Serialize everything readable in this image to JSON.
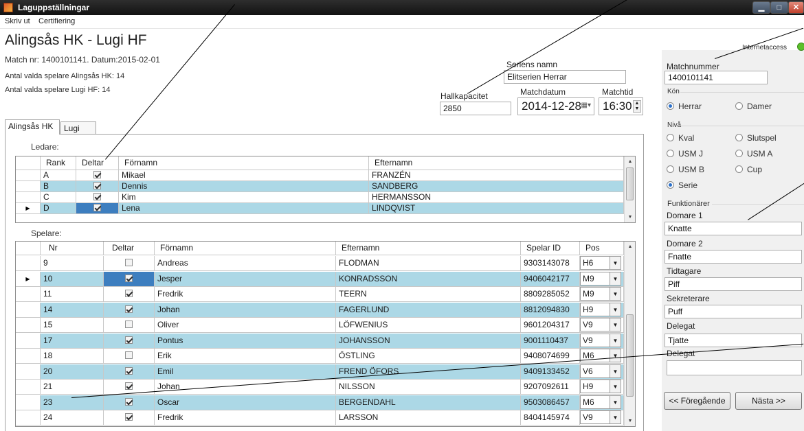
{
  "window": {
    "title": "Laguppställningar"
  },
  "menu": [
    "Skriv ut",
    "Certifiering"
  ],
  "match": {
    "title": "Alingsås HK - Lugi HF",
    "info_line": "Match nr: 1400101141.  Datum:2015-02-01",
    "count_home": "Antal valda spelare Alingsås HK: 14",
    "count_away": "Antal valda spelare Lugi HF: 14"
  },
  "fields": {
    "series_label": "Seriens namn",
    "series_value": "Elitserien Herrar",
    "capacity_label": "Hallkapacitet",
    "capacity_value": "2850",
    "date_label": "Matchdatum",
    "date_value": "2014-12-28",
    "time_label": "Matchtid",
    "time_value": "16:30"
  },
  "panel": {
    "internet_label": "Internetaccess",
    "matchnr_label": "Matchnummer",
    "matchnr_value": "1400101141",
    "gender_title": "Kön",
    "gender": [
      {
        "label": "Herrar",
        "checked": true
      },
      {
        "label": "Damer",
        "checked": false
      }
    ],
    "level_title": "Nivå",
    "levels": [
      {
        "label": "Kval",
        "checked": false
      },
      {
        "label": "Slutspel",
        "checked": false
      },
      {
        "label": "USM J",
        "checked": false
      },
      {
        "label": "USM A",
        "checked": false
      },
      {
        "label": "USM B",
        "checked": false
      },
      {
        "label": "Cup",
        "checked": false
      },
      {
        "label": "Serie",
        "checked": true
      }
    ],
    "officials_title": "Funktionärer",
    "officials": [
      {
        "label": "Domare 1",
        "value": "Knatte"
      },
      {
        "label": "Domare 2",
        "value": "Fnatte"
      },
      {
        "label": "Tidtagare",
        "value": "Piff"
      },
      {
        "label": "Sekreterare",
        "value": "Puff"
      },
      {
        "label": "Delegat",
        "value": "Tjatte"
      },
      {
        "label": "Delegat",
        "value": ""
      }
    ],
    "prev_button": "<< Föregående",
    "next_button": "Nästa >>"
  },
  "tabs": [
    {
      "label": "Alingsås HK",
      "active": true
    },
    {
      "label": "Lugi HF",
      "active": false
    }
  ],
  "leaders": {
    "caption": "Ledare:",
    "headers": [
      "Rank",
      "Deltar",
      "Förnamn",
      "Efternamn"
    ],
    "rows": [
      {
        "rank": "A",
        "deltar": true,
        "first": "Mikael",
        "last": "FRANZÉN",
        "hl": false
      },
      {
        "rank": "B",
        "deltar": true,
        "first": "Dennis",
        "last": "SANDBERG",
        "hl": true
      },
      {
        "rank": "C",
        "deltar": true,
        "first": "Kim",
        "last": "HERMANSSON",
        "hl": false
      },
      {
        "rank": "D",
        "deltar": true,
        "first": "Lena",
        "last": "LINDQVIST",
        "hl": true,
        "current": true
      }
    ]
  },
  "players": {
    "caption": "Spelare:",
    "headers": [
      "Nr",
      "Deltar",
      "Förnamn",
      "Efternamn",
      "Spelar ID",
      "Pos"
    ],
    "rows": [
      {
        "nr": "9",
        "deltar": false,
        "first": "Andreas",
        "last": "FLODMAN",
        "id": "9303143078",
        "pos": "H6",
        "hl": false
      },
      {
        "nr": "10",
        "deltar": true,
        "first": "Jesper",
        "last": "KONRADSSON",
        "id": "9406042177",
        "pos": "M9",
        "hl": true,
        "current": true
      },
      {
        "nr": "11",
        "deltar": true,
        "first": "Fredrik",
        "last": "TEERN",
        "id": "8809285052",
        "pos": "M9",
        "hl": false
      },
      {
        "nr": "14",
        "deltar": true,
        "first": "Johan",
        "last": "FAGERLUND",
        "id": "8812094830",
        "pos": "H9",
        "hl": true
      },
      {
        "nr": "15",
        "deltar": false,
        "first": "Oliver",
        "last": "LÖFWENIUS",
        "id": "9601204317",
        "pos": "V9",
        "hl": false
      },
      {
        "nr": "17",
        "deltar": true,
        "first": "Pontus",
        "last": "JOHANSSON",
        "id": "9001110437",
        "pos": "V9",
        "hl": true
      },
      {
        "nr": "18",
        "deltar": false,
        "first": "Erik",
        "last": "ÖSTLING",
        "id": "9408074699",
        "pos": "M6",
        "hl": false
      },
      {
        "nr": "20",
        "deltar": true,
        "first": "Emil",
        "last": "FREND ÖFORS",
        "id": "9409133452",
        "pos": "V6",
        "hl": true
      },
      {
        "nr": "21",
        "deltar": true,
        "first": "Johan",
        "last": "NILSSON",
        "id": "9207092611",
        "pos": "H9",
        "hl": false
      },
      {
        "nr": "23",
        "deltar": true,
        "first": "Oscar",
        "last": "BERGENDAHL",
        "id": "9503086457",
        "pos": "M6",
        "hl": true
      },
      {
        "nr": "24",
        "deltar": true,
        "first": "Fredrik",
        "last": "LARSSON",
        "id": "8404145974",
        "pos": "V9",
        "hl": false
      }
    ]
  },
  "colors": {
    "row_highlight": "#acd8e6",
    "selected_cell": "#3d7ebf",
    "status_green": "#5cc02a"
  }
}
